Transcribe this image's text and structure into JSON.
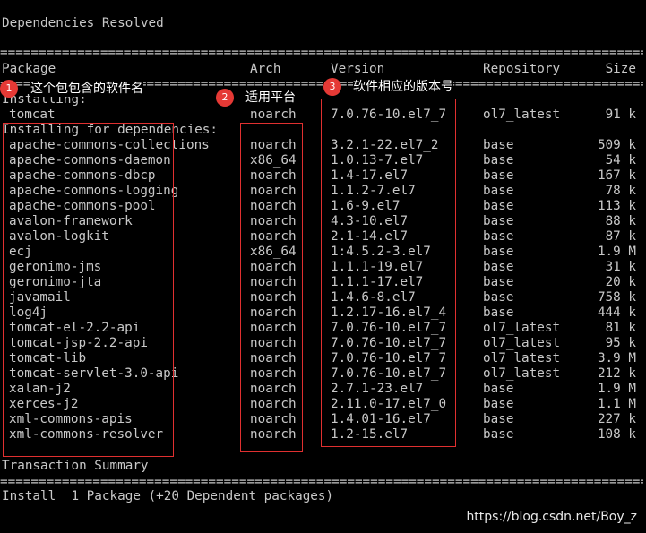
{
  "title": "Dependencies Resolved",
  "separator": "================================================================================================",
  "headers": {
    "package": "Package",
    "arch": "Arch",
    "version": "Version",
    "repository": "Repository",
    "size": "Size"
  },
  "sections": {
    "installing": "Installing:",
    "installing_deps": "Installing for dependencies:"
  },
  "main_package": {
    "name": "tomcat",
    "arch": "noarch",
    "version": "7.0.76-10.el7_7",
    "repo": "ol7_latest",
    "size": "91 k"
  },
  "dependencies": [
    {
      "name": "apache-commons-collections",
      "arch": "noarch",
      "version": "3.2.1-22.el7_2",
      "repo": "base",
      "size": "509 k"
    },
    {
      "name": "apache-commons-daemon",
      "arch": "x86_64",
      "version": "1.0.13-7.el7",
      "repo": "base",
      "size": "54 k"
    },
    {
      "name": "apache-commons-dbcp",
      "arch": "noarch",
      "version": "1.4-17.el7",
      "repo": "base",
      "size": "167 k"
    },
    {
      "name": "apache-commons-logging",
      "arch": "noarch",
      "version": "1.1.2-7.el7",
      "repo": "base",
      "size": "78 k"
    },
    {
      "name": "apache-commons-pool",
      "arch": "noarch",
      "version": "1.6-9.el7",
      "repo": "base",
      "size": "113 k"
    },
    {
      "name": "avalon-framework",
      "arch": "noarch",
      "version": "4.3-10.el7",
      "repo": "base",
      "size": "88 k"
    },
    {
      "name": "avalon-logkit",
      "arch": "noarch",
      "version": "2.1-14.el7",
      "repo": "base",
      "size": "87 k"
    },
    {
      "name": "ecj",
      "arch": "x86_64",
      "version": "1:4.5.2-3.el7",
      "repo": "base",
      "size": "1.9 M"
    },
    {
      "name": "geronimo-jms",
      "arch": "noarch",
      "version": "1.1.1-19.el7",
      "repo": "base",
      "size": "31 k"
    },
    {
      "name": "geronimo-jta",
      "arch": "noarch",
      "version": "1.1.1-17.el7",
      "repo": "base",
      "size": "20 k"
    },
    {
      "name": "javamail",
      "arch": "noarch",
      "version": "1.4.6-8.el7",
      "repo": "base",
      "size": "758 k"
    },
    {
      "name": "log4j",
      "arch": "noarch",
      "version": "1.2.17-16.el7_4",
      "repo": "base",
      "size": "444 k"
    },
    {
      "name": "tomcat-el-2.2-api",
      "arch": "noarch",
      "version": "7.0.76-10.el7_7",
      "repo": "ol7_latest",
      "size": "81 k"
    },
    {
      "name": "tomcat-jsp-2.2-api",
      "arch": "noarch",
      "version": "7.0.76-10.el7_7",
      "repo": "ol7_latest",
      "size": "95 k"
    },
    {
      "name": "tomcat-lib",
      "arch": "noarch",
      "version": "7.0.76-10.el7_7",
      "repo": "ol7_latest",
      "size": "3.9 M"
    },
    {
      "name": "tomcat-servlet-3.0-api",
      "arch": "noarch",
      "version": "7.0.76-10.el7_7",
      "repo": "ol7_latest",
      "size": "212 k"
    },
    {
      "name": "xalan-j2",
      "arch": "noarch",
      "version": "2.7.1-23.el7",
      "repo": "base",
      "size": "1.9 M"
    },
    {
      "name": "xerces-j2",
      "arch": "noarch",
      "version": "2.11.0-17.el7_0",
      "repo": "base",
      "size": "1.1 M"
    },
    {
      "name": "xml-commons-apis",
      "arch": "noarch",
      "version": "1.4.01-16.el7",
      "repo": "base",
      "size": "227 k"
    },
    {
      "name": "xml-commons-resolver",
      "arch": "noarch",
      "version": "1.2-15.el7",
      "repo": "base",
      "size": "108 k"
    }
  ],
  "summary_title": "Transaction Summary",
  "install_line": "Install  1 Package (+20 Dependent packages)",
  "annotations": [
    {
      "num": "1",
      "text": "这个包包含的软件名"
    },
    {
      "num": "2",
      "text": "适用平台"
    },
    {
      "num": "3",
      "text": "软件相应的版本号"
    }
  ],
  "watermark": "https://blog.csdn.net/Boy_z",
  "colors": {
    "background": "#000000",
    "text": "#c8c8c8",
    "highlight": "#e03030",
    "badge": "#e53935"
  }
}
